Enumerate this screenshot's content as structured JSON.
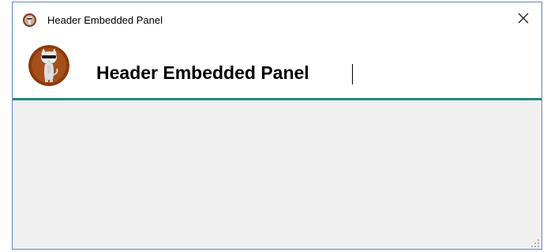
{
  "window": {
    "title": "Header Embedded Panel",
    "app_icon": "cat-logo-icon",
    "close_icon": "close-icon"
  },
  "header": {
    "title": "Header Embedded Panel",
    "avatar": "cat-avatar-icon"
  },
  "colors": {
    "divider": "#1f8a80",
    "avatar_bg": "#8b3a0c",
    "content_bg": "#f0f0f0",
    "window_border": "#5b88c8"
  }
}
